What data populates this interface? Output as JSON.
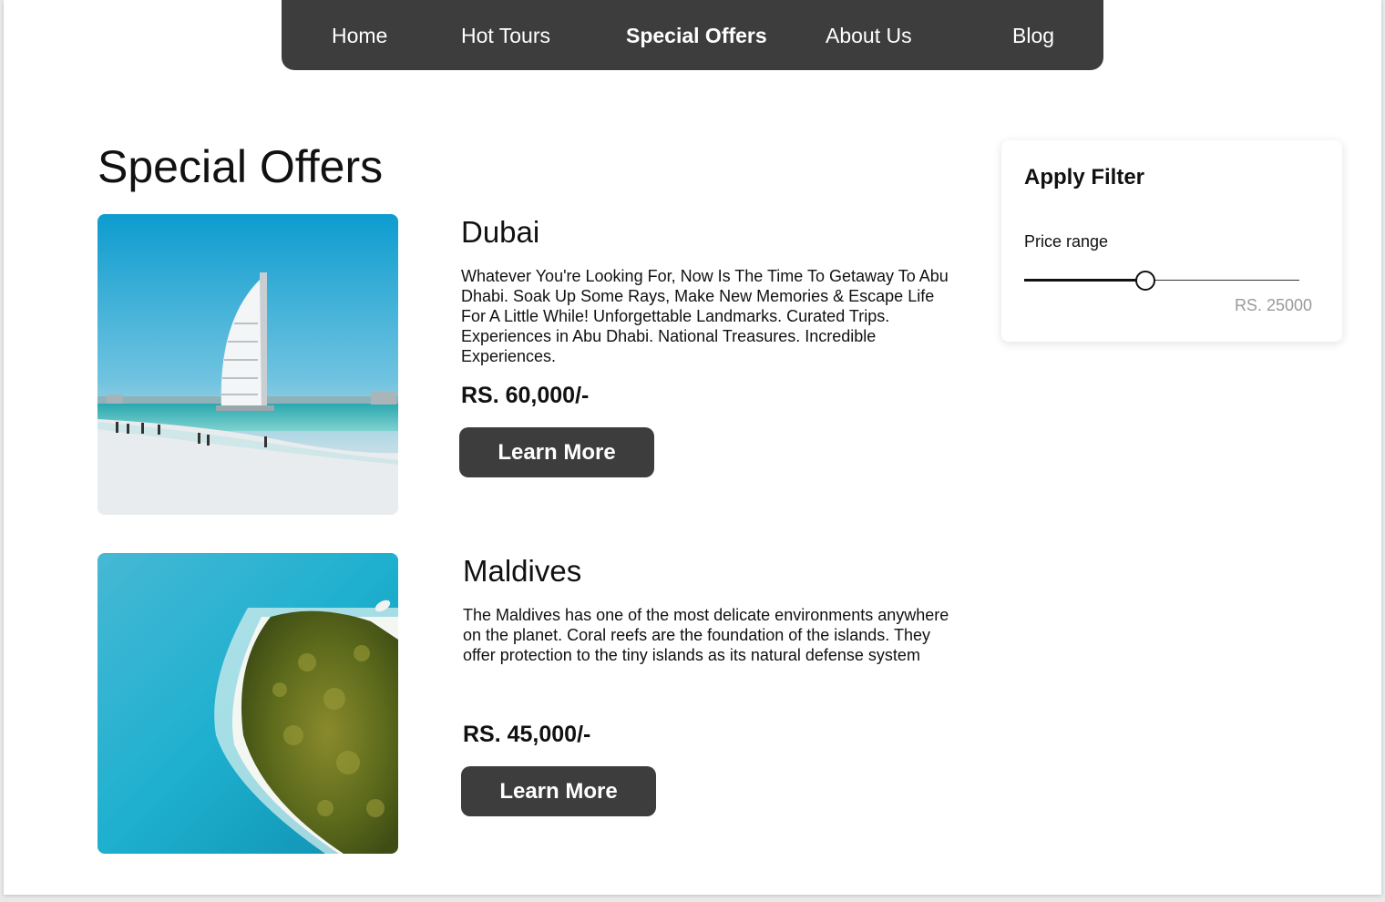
{
  "nav": {
    "items": [
      {
        "label": "Home",
        "active": false
      },
      {
        "label": "Hot Tours",
        "active": false
      },
      {
        "label": "Special Offers",
        "active": true
      },
      {
        "label": "About Us",
        "active": false
      },
      {
        "label": "Blog",
        "active": false
      }
    ]
  },
  "page_title": "Special Offers",
  "offers": [
    {
      "name": "Dubai",
      "description": "Whatever You're Looking For, Now Is The Time To Getaway To Abu Dhabi. Soak Up Some Rays, Make New Memories & Escape Life For A Little While! Unforgettable Landmarks. Curated Trips. Experiences in Abu Dhabi. National Treasures. Incredible Experiences.",
      "price": "RS. 60,000/-",
      "button_label": "Learn More"
    },
    {
      "name": "Maldives",
      "description": "The Maldives has one of the most delicate environments anywhere on the planet. Coral reefs are the foundation of the islands. They offer protection to the tiny islands as its natural defense system",
      "price": "RS. 45,000/-",
      "button_label": "Learn More"
    }
  ],
  "filter": {
    "title": "Apply Filter",
    "price_label": "Price range",
    "value_text": "RS. 25000",
    "slider_fraction": 0.44
  },
  "colors": {
    "nav_bg": "#3d3d3d",
    "button_bg": "#3d3d3d",
    "muted_text": "#9a9a9a"
  }
}
